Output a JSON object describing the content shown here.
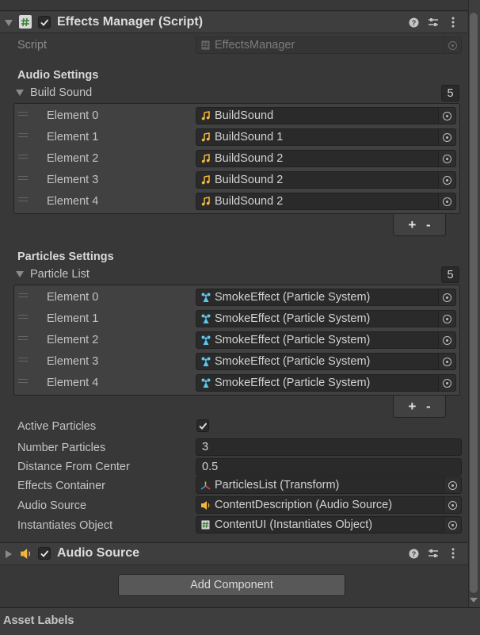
{
  "component": {
    "title": "Effects Manager (Script)",
    "enabled": true,
    "script_label": "Script",
    "script_value": "EffectsManager"
  },
  "audio_settings": {
    "heading": "Audio Settings",
    "list_label": "Build Sound",
    "count": "5",
    "elements": [
      {
        "label": "Element 0",
        "value": "BuildSound"
      },
      {
        "label": "Element 1",
        "value": "BuildSound 1"
      },
      {
        "label": "Element 2",
        "value": "BuildSound 2"
      },
      {
        "label": "Element 3",
        "value": "BuildSound 2"
      },
      {
        "label": "Element 4",
        "value": "BuildSound 2"
      }
    ]
  },
  "particle_settings": {
    "heading": "Particles Settings",
    "list_label": "Particle List",
    "count": "5",
    "elements": [
      {
        "label": "Element 0",
        "value": "SmokeEffect (Particle System)"
      },
      {
        "label": "Element 1",
        "value": "SmokeEffect (Particle System)"
      },
      {
        "label": "Element 2",
        "value": "SmokeEffect (Particle System)"
      },
      {
        "label": "Element 3",
        "value": "SmokeEffect (Particle System)"
      },
      {
        "label": "Element 4",
        "value": "SmokeEffect (Particle System)"
      }
    ]
  },
  "list_buttons": {
    "add": "+",
    "remove": "-"
  },
  "fields": {
    "active_particles": {
      "label": "Active Particles",
      "checked": true
    },
    "number_particles": {
      "label": "Number Particles",
      "value": "3"
    },
    "distance_from_center": {
      "label": "Distance From Center",
      "value": "0.5"
    },
    "effects_container": {
      "label": "Effects Container",
      "value": "ParticlesList (Transform)"
    },
    "audio_source": {
      "label": "Audio Source",
      "value": "ContentDescription (Audio Source)"
    },
    "instantiates_object": {
      "label": "Instantiates Object",
      "value": "ContentUI (Instantiates Object)"
    }
  },
  "audio_component": {
    "title": "Audio Source",
    "enabled": true
  },
  "add_component_label": "Add Component",
  "asset_labels": "Asset Labels",
  "icons": {
    "script": "hash-script-icon",
    "audio_clip": "music-note-icon",
    "particle": "particle-system-icon",
    "transform": "transform-axes-icon",
    "audio_source": "speaker-icon",
    "help": "help-icon",
    "presets": "sliders-icon",
    "menu": "kebab-menu-icon",
    "picker": "object-picker-icon"
  },
  "colors": {
    "background": "#383838",
    "field": "#2a2a2a",
    "audio_icon": "#f5b73b",
    "particle_icon": "#5cc8f0",
    "button": "#585858"
  }
}
